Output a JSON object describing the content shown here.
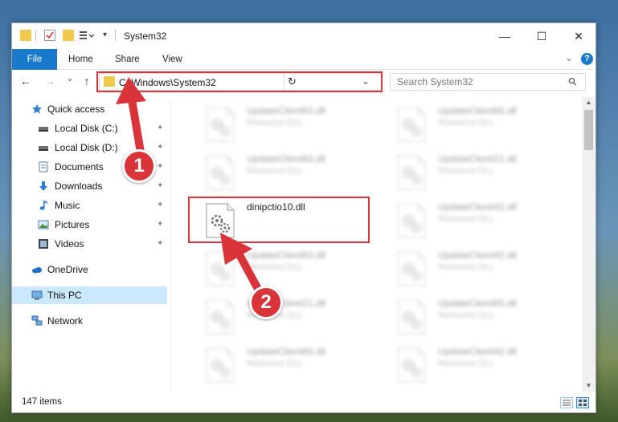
{
  "window": {
    "title": "System32",
    "minimize_glyph": "—",
    "maximize_glyph": "☐",
    "close_glyph": "✕"
  },
  "ribbon": {
    "tabs": [
      {
        "label": "File",
        "active": true
      },
      {
        "label": "Home"
      },
      {
        "label": "Share"
      },
      {
        "label": "View"
      }
    ],
    "expand_glyph": "⌄",
    "help_glyph": "?"
  },
  "navbar": {
    "back_glyph": "←",
    "forward_glyph": "→",
    "recent_glyph": "⌄",
    "up_glyph": "↑",
    "address": "C:\\Windows\\System32",
    "dropdown_glyph": "⌄",
    "refresh_glyph": "↻",
    "search_placeholder": "Search System32",
    "search_icon_glyph": "⚲"
  },
  "sidebar": {
    "items": [
      {
        "label": "Quick access",
        "icon": "star-icon",
        "pinned": false
      },
      {
        "label": "Local Disk (C:)",
        "icon": "drive-icon",
        "pinned": true
      },
      {
        "label": "Local Disk (D:)",
        "icon": "drive-icon",
        "pinned": true
      },
      {
        "label": "Documents",
        "icon": "documents-icon",
        "pinned": true
      },
      {
        "label": "Downloads",
        "icon": "download-icon",
        "pinned": true
      },
      {
        "label": "Music",
        "icon": "music-icon",
        "pinned": true
      },
      {
        "label": "Pictures",
        "icon": "pictures-icon",
        "pinned": true
      },
      {
        "label": "Videos",
        "icon": "videos-icon",
        "pinned": true
      },
      {
        "label": "OneDrive",
        "icon": "cloud-icon",
        "pinned": false
      },
      {
        "label": "This PC",
        "icon": "computer-icon",
        "pinned": false,
        "selected": true
      },
      {
        "label": "Network",
        "icon": "network-icon",
        "pinned": false
      }
    ],
    "pin_glyph": "📌"
  },
  "files": [
    {
      "name": "UpdateClient63.dll",
      "type": "Resource DLL",
      "blurred": true
    },
    {
      "name": "UpdateClient65.dll",
      "type": "Resource DLL",
      "blurred": true
    },
    {
      "name": "UpdateClient63.dll",
      "type": "Resource DLL",
      "blurred": true
    },
    {
      "name": "UpdateClient21.dll",
      "type": "Resource DLL",
      "blurred": true
    },
    {
      "name": "dinipctio10.dll",
      "type": "",
      "blurred": false,
      "highlighted": true
    },
    {
      "name": "UpdateClient42.dll",
      "type": "Resource DLL",
      "blurred": true
    },
    {
      "name": "UpdateClient63.dll",
      "type": "Resource DLL",
      "blurred": true
    },
    {
      "name": "UpdateClient42.dll",
      "type": "Resource DLL",
      "blurred": true
    },
    {
      "name": "UpdateClient21.dll",
      "type": "Resource DLL",
      "blurred": true
    },
    {
      "name": "UpdateClient65.dll",
      "type": "Resource DLL",
      "blurred": true
    },
    {
      "name": "UpdateClient65.dll",
      "type": "Resource DLL",
      "blurred": true
    },
    {
      "name": "UpdateClient42.dll",
      "type": "Resource DLL",
      "blurred": true
    }
  ],
  "status": {
    "item_count": "147 items"
  },
  "annotations": {
    "step1": "1",
    "step2": "2"
  },
  "colors": {
    "accent": "#1979ca",
    "highlight_red": "#d9343a",
    "selected_bg": "#cce8ff",
    "folder": "#f3c94b"
  }
}
